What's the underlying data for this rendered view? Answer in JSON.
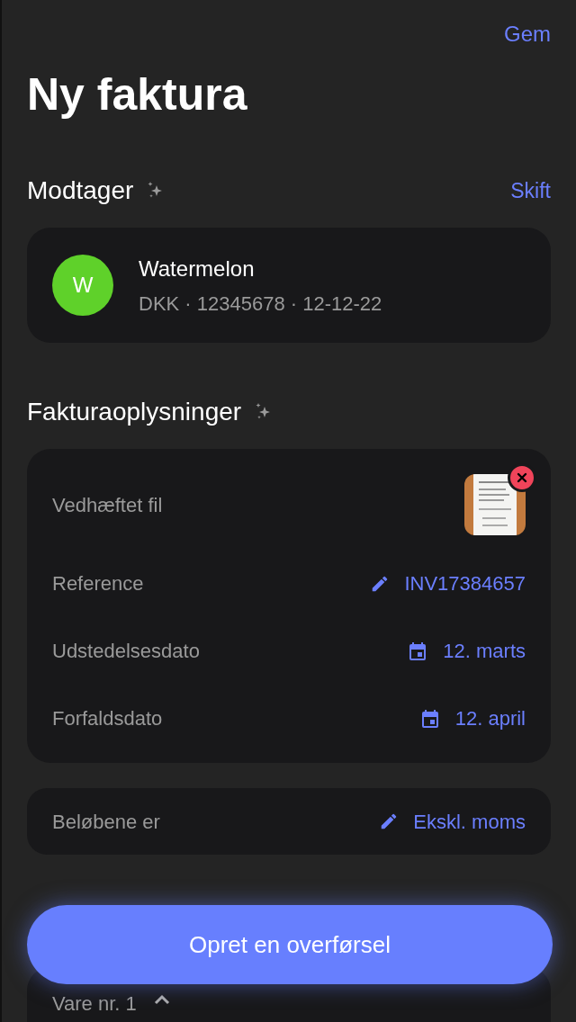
{
  "header": {
    "action": "Gem",
    "title": "Ny faktura"
  },
  "recipient": {
    "heading": "Modtager",
    "action": "Skift",
    "initial": "W",
    "color": "#5fd12a",
    "name": "Watermelon",
    "details": "DKK · 12345678 · 12-12-22"
  },
  "invoice": {
    "heading": "Fakturaoplysninger",
    "rows": [
      {
        "kind": "attachment",
        "label": "Vedhæftet fil"
      },
      {
        "kind": "edit",
        "label": "Reference",
        "value": "INV17384657"
      },
      {
        "kind": "date",
        "label": "Udstedelsesdato",
        "value": "12. marts"
      },
      {
        "kind": "date",
        "label": "Forfaldsdato",
        "value": "12. april"
      }
    ]
  },
  "amounts": {
    "label": "Beløbene er",
    "value": "Ekskl. moms"
  },
  "item": {
    "label": "Vare nr. 1",
    "expanded": true
  },
  "primary_button": "Opret en overførsel"
}
